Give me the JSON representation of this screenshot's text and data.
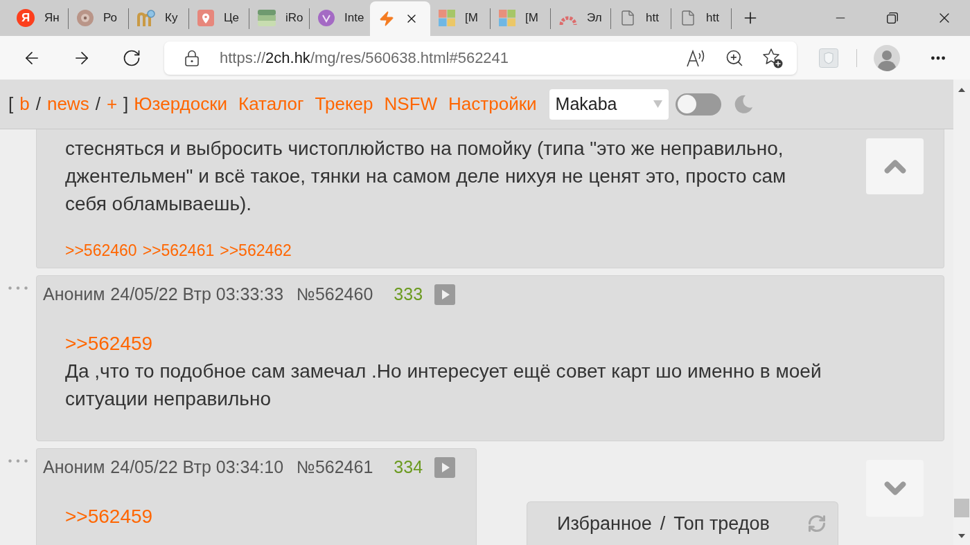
{
  "browser": {
    "tabs": [
      {
        "title": "Ян",
        "favicon_letter": "Я",
        "selected": false
      },
      {
        "title": "Ро",
        "selected": false
      },
      {
        "title": "Ку",
        "selected": false
      },
      {
        "title": "Це",
        "selected": false
      },
      {
        "title": "iRo",
        "selected": false
      },
      {
        "title": "Inte",
        "selected": false
      },
      {
        "selected": true
      },
      {
        "title": "[M",
        "selected": false
      },
      {
        "title": "[M",
        "selected": false
      },
      {
        "title": "Эл",
        "selected": false
      },
      {
        "title": "htt",
        "selected": false
      },
      {
        "title": "htt",
        "selected": false
      }
    ],
    "address": {
      "scheme": "https://",
      "host": "2ch.hk",
      "path": "/mg/res/560638.html#562241"
    }
  },
  "header": {
    "board_nav": [
      {
        "kind": "bracket",
        "text": "["
      },
      {
        "kind": "link",
        "text": "b"
      },
      {
        "kind": "slash",
        "text": "/"
      },
      {
        "kind": "link",
        "text": "news"
      },
      {
        "kind": "slash",
        "text": "/"
      },
      {
        "kind": "link",
        "text": "+"
      },
      {
        "kind": "bracket",
        "text": "]"
      }
    ],
    "links": [
      "Юзердоски",
      "Каталог",
      "Трекер",
      "NSFW",
      "Настройки"
    ],
    "style_select": {
      "value": "Makaba"
    },
    "theme_toggle": {
      "on": false
    }
  },
  "posts": [
    {
      "lines": [
        "стесняться и выбросить чистоплюйство на помойку (типа \"это же неправильно,",
        "джентельмен\" и всё такое, тянки на самом деле нихуя не ценят это, просто сам",
        "себя обламываешь)."
      ],
      "replies": [
        ">>562460",
        ">>562461",
        ">>562462"
      ]
    },
    {
      "author": "Аноним",
      "date": "24/05/22 Втр 03:33:33",
      "number": "№562460",
      "ordinal": "333",
      "reply_to": ">>562459",
      "lines": [
        "Да ,что то подобное сам замечал .Но интересует ещё совет карт шо именно в моей",
        "ситуации неправильно"
      ]
    },
    {
      "author": "Аноним",
      "date": "24/05/22 Втр 03:34:10",
      "number": "№562461",
      "ordinal": "334",
      "reply_to": ">>562459"
    }
  ],
  "favorites_panel": {
    "tabs": [
      {
        "label": "Избранное"
      },
      {
        "label": "Топ тредов"
      }
    ],
    "separator": "/"
  }
}
